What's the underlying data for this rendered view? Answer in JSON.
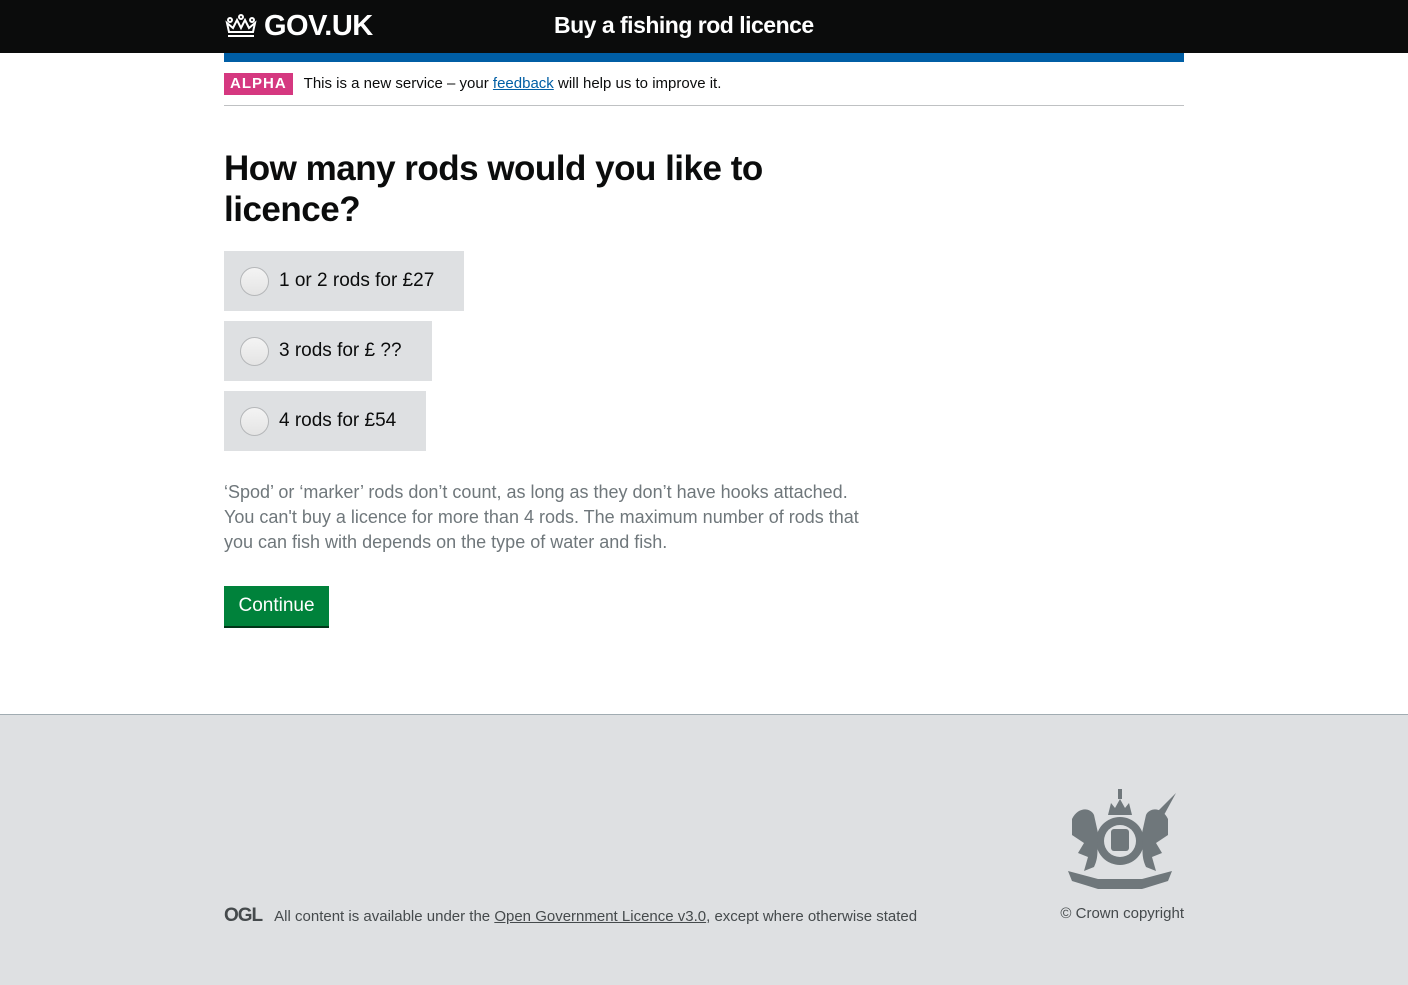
{
  "header": {
    "logo_text": "GOV.UK",
    "logo_icon": "crown-icon",
    "service_name": "Buy a fishing rod licence"
  },
  "phase_banner": {
    "tag": "ALPHA",
    "text_before": "This is a new service – your ",
    "link": "feedback",
    "text_after": " will help us to improve it."
  },
  "main": {
    "title": "How many rods would you like to licence?",
    "options": [
      {
        "label": "1 or 2 rods for £27",
        "selected": false
      },
      {
        "label": "3 rods for £ ??",
        "selected": false
      },
      {
        "label": "4 rods for £54",
        "selected": false
      }
    ],
    "hint": "‘Spod’ or ‘marker’ rods don’t count, as long as they don’t have hooks attached. You can't buy a licence for more than 4 rods. The maximum number of rods that you can fish with depends on the type of water and fish.",
    "continue_label": "Continue"
  },
  "footer": {
    "ogl_logo": "OGL",
    "licence_before": "All content is available under the ",
    "licence_link": "Open Government Licence v3.0",
    "licence_after": ", except where otherwise stated",
    "copyright": "© Crown copyright",
    "crest_icon": "royal-coat-of-arms-icon"
  },
  "colors": {
    "header": "#0b0c0c",
    "blue_bar": "#005ea5",
    "alpha_tag": "#d53880",
    "button": "#00823b",
    "footer": "#dee0e2"
  }
}
